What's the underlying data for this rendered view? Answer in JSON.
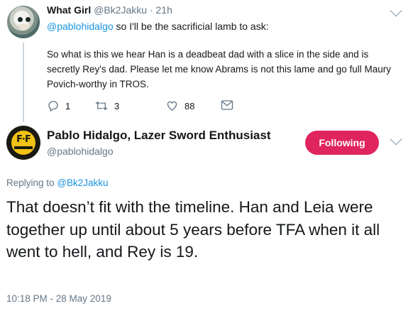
{
  "parent_tweet": {
    "display_name": "What Girl",
    "handle": "@Bk2Jakku",
    "separator": "·",
    "time": "21h",
    "reply_mention": "@pablohidalgo",
    "reply_rest": " so I'll be the sacrificial lamb to ask:",
    "text": "So what is this we hear Han is a deadbeat dad with a slice in the side and is secretly Rey's dad. Please let me know Abrams is not this lame and go full Maury Povich-worthy in TROS.",
    "actions": {
      "reply_count": "1",
      "retweet_count": "3",
      "like_count": "88"
    },
    "icons": [
      "reply-icon",
      "retweet-icon",
      "like-icon",
      "message-icon",
      "chevron-down-icon"
    ]
  },
  "main_tweet": {
    "display_name": "Pablo Hidalgo, Lazer Sword Enthusiast",
    "handle": "@pablohidalgo",
    "follow_label": "Following",
    "replying_to_prefix": "Replying to ",
    "replying_to_handle": "@Bk2Jakku",
    "text": "That doesn’t fit with the timeline. Han and Leia were together up until about 5 years before TFA when it all went to hell, and Rey is 19.",
    "timestamp": "10:18 PM - 28 May 2019",
    "avatar_logo": "F∙F"
  },
  "colors": {
    "link": "#1b95e0",
    "follow_button": "#e0245e",
    "secondary_text": "#657786",
    "primary_text": "#14171a"
  }
}
